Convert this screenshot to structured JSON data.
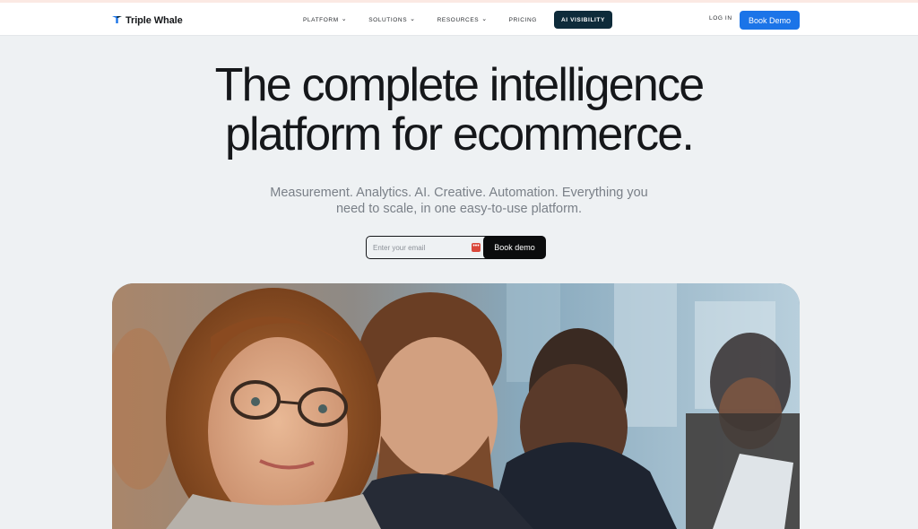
{
  "brand": {
    "name": "Triple Whale"
  },
  "nav": {
    "items": [
      {
        "label": "PLATFORM",
        "dropdown": true
      },
      {
        "label": "SOLUTIONS",
        "dropdown": true
      },
      {
        "label": "RESOURCES",
        "dropdown": true
      },
      {
        "label": "PRICING",
        "dropdown": false
      }
    ],
    "badge": "AI VISIBILITY",
    "login": "LOG IN",
    "cta": "Book Demo"
  },
  "hero": {
    "headline_line1": "The complete intelligence",
    "headline_line2": "platform for ecommerce.",
    "subtitle_line1": "Measurement. Analytics. AI. Creative. Automation. Everything you",
    "subtitle_line2": "need to scale, in one easy-to-use platform.",
    "email_placeholder": "Enter your email",
    "form_cta": "Book demo",
    "image": "photo of smiling people working at laptops in an office"
  },
  "colors": {
    "background": "#eef1f3",
    "primary_button": "#1b74e8",
    "ai_badge": "#0e2b3a",
    "form_button": "#0b0c0d",
    "subtitle": "#7a8088"
  },
  "icons": {
    "logo": "whale-tail-icon",
    "chevron": "chevron-down-icon",
    "password_manager": "password-manager-icon"
  }
}
